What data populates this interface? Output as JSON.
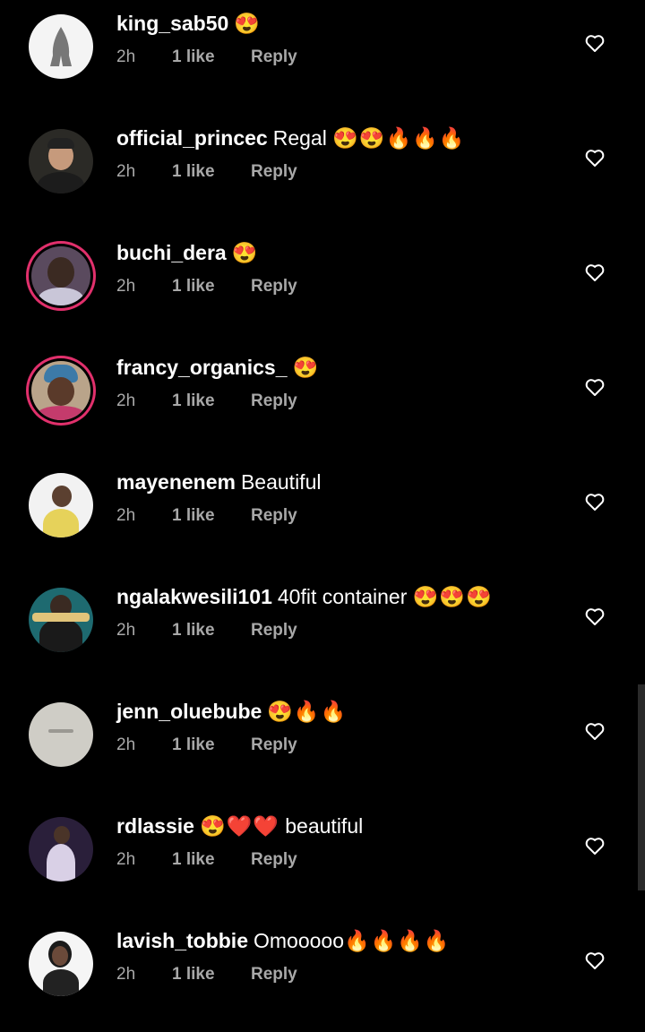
{
  "comments": [
    {
      "username": "king_sab50",
      "text": "",
      "emoji": "😍",
      "time": "2h",
      "likes": "1 like",
      "reply": "Reply"
    },
    {
      "username": "official_princec",
      "text": "Regal",
      "emoji": "😍😍🔥🔥🔥",
      "time": "2h",
      "likes": "1 like",
      "reply": "Reply"
    },
    {
      "username": "buchi_dera",
      "text": "",
      "emoji": "😍",
      "time": "2h",
      "likes": "1 like",
      "reply": "Reply"
    },
    {
      "username": "francy_organics_",
      "text": "",
      "emoji": "😍",
      "time": "2h",
      "likes": "1 like",
      "reply": "Reply"
    },
    {
      "username": "mayenenem",
      "text": "Beautiful",
      "emoji": "",
      "time": "2h",
      "likes": "1 like",
      "reply": "Reply"
    },
    {
      "username": "ngalakwesili101",
      "text": "40fit container",
      "emoji": "😍😍😍",
      "time": "2h",
      "likes": "1 like",
      "reply": "Reply"
    },
    {
      "username": "jenn_oluebube",
      "text": "",
      "emoji": "😍🔥🔥",
      "time": "2h",
      "likes": "1 like",
      "reply": "Reply"
    },
    {
      "username": "rdlassie",
      "text": "",
      "emoji": "😍❤️❤️",
      "suffix": "beautiful",
      "time": "2h",
      "likes": "1 like",
      "reply": "Reply"
    },
    {
      "username": "lavish_tobbie",
      "text": "Omooooo",
      "emoji": "🔥🔥🔥🔥",
      "time": "2h",
      "likes": "1 like",
      "reply": "Reply"
    }
  ],
  "colors": {
    "background": "#000000",
    "meta": "#a8a8a8",
    "story_ring": "#e1306c"
  },
  "icons": {
    "like": "heart-outline-icon"
  }
}
